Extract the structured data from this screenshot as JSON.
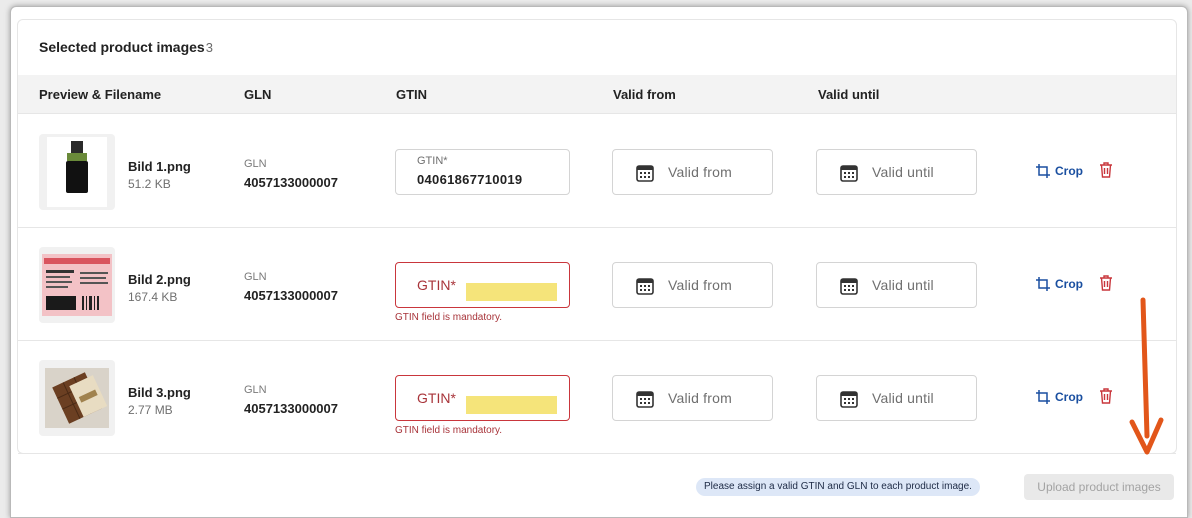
{
  "section": {
    "title": "Selected product images",
    "count": "3"
  },
  "columns": {
    "preview": "Preview & Filename",
    "gln": "GLN",
    "gtin": "GTIN",
    "valid_from": "Valid from",
    "valid_until": "Valid until"
  },
  "rows": [
    {
      "filename": "Bild 1.png",
      "size": "51.2 KB",
      "gln_label": "GLN",
      "gln": "4057133000007",
      "gtin_label": "GTIN*",
      "gtin": "04061867710019",
      "valid_from_placeholder": "Valid from",
      "valid_until_placeholder": "Valid until",
      "crop_label": "Crop",
      "thumbnail_icon": "bottle-image-icon"
    },
    {
      "filename": "Bild 2.png",
      "size": "167.4 KB",
      "gln_label": "GLN",
      "gln": "4057133000007",
      "gtin_placeholder": "GTIN*",
      "gtin_error": "GTIN field is mandatory.",
      "valid_from_placeholder": "Valid from",
      "valid_until_placeholder": "Valid until",
      "crop_label": "Crop",
      "thumbnail_icon": "label-image-icon"
    },
    {
      "filename": "Bild 3.png",
      "size": "2.77 MB",
      "gln_label": "GLN",
      "gln": "4057133000007",
      "gtin_placeholder": "GTIN*",
      "gtin_error": "GTIN field is mandatory.",
      "valid_from_placeholder": "Valid from",
      "valid_until_placeholder": "Valid until",
      "crop_label": "Crop",
      "thumbnail_icon": "chocolate-image-icon"
    }
  ],
  "footer": {
    "notice": "Please assign a valid GTIN and GLN to each product image.",
    "upload_label": "Upload product images"
  },
  "colors": {
    "error": "#c9363c",
    "link": "#1a4fa0",
    "trash": "#c9363c",
    "annotation_arrow": "#e2561a",
    "highlight": "#f5e47a"
  }
}
